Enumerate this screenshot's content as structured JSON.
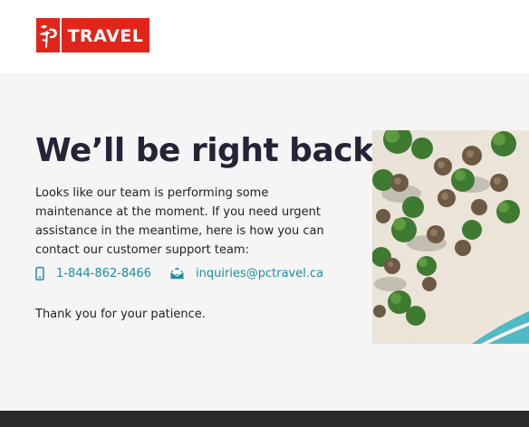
{
  "header": {
    "logo_text": "TRAVEL",
    "brand_color": "#e1251b"
  },
  "main": {
    "headline": "We’ll be right back.",
    "message": "Looks like our team is performing some maintenance at the moment. If you need urgent assistance in the meantime, here is how you can contact our customer support team:",
    "phone": "1-844-862-8466",
    "email": "inquiries@pctravel.ca",
    "thanks": "Thank you for your patience."
  },
  "colors": {
    "headline": "#262338",
    "link": "#1b8ea0",
    "page_background": "#f5f5f5",
    "footer": "#2a2a2a"
  },
  "icons": {
    "phone": "phone-icon",
    "email": "envelope-icon",
    "logo": "pc-flag-logo-icon"
  }
}
